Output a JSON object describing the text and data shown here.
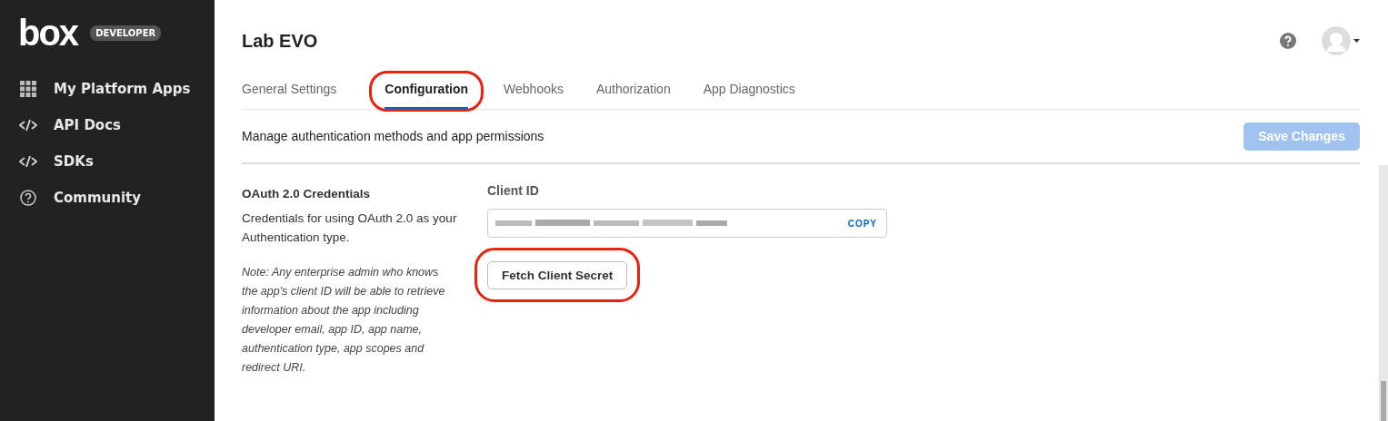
{
  "sidebar": {
    "logo": "box",
    "badge": "DEVELOPER",
    "items": [
      {
        "label": "My Platform Apps",
        "kind": "grid",
        "selected": false
      },
      {
        "label": "API Docs",
        "kind": "code",
        "selected": false
      },
      {
        "label": "SDKs",
        "kind": "code",
        "selected": false
      },
      {
        "label": "Community",
        "kind": "help",
        "selected": false
      }
    ]
  },
  "header": {
    "title": "Lab EVO"
  },
  "tabs": [
    {
      "label": "General Settings",
      "selected": false,
      "circled": false
    },
    {
      "label": "Configuration",
      "selected": true,
      "circled": true
    },
    {
      "label": "Webhooks",
      "selected": false,
      "circled": false
    },
    {
      "label": "Authorization",
      "selected": false,
      "circled": false
    },
    {
      "label": "App Diagnostics",
      "selected": false,
      "circled": false
    }
  ],
  "toolbar": {
    "description": "Manage authentication methods and app permissions",
    "save_button": {
      "label": "Save Changes",
      "disabled": true
    }
  },
  "section": {
    "title": "OAuth 2.0 Credentials",
    "description": "Credentials for using OAuth 2.0 as your Authentication type.",
    "note": "Note: Any enterprise admin who knows the app's client ID will be able to retrieve information about the app including developer email, app ID, app name, authentication type, app scopes and redirect URI.",
    "client_id": {
      "label": "Client ID",
      "copy": "COPY"
    },
    "fetch_button": {
      "label": "Fetch Client Secret",
      "circled": true
    }
  }
}
